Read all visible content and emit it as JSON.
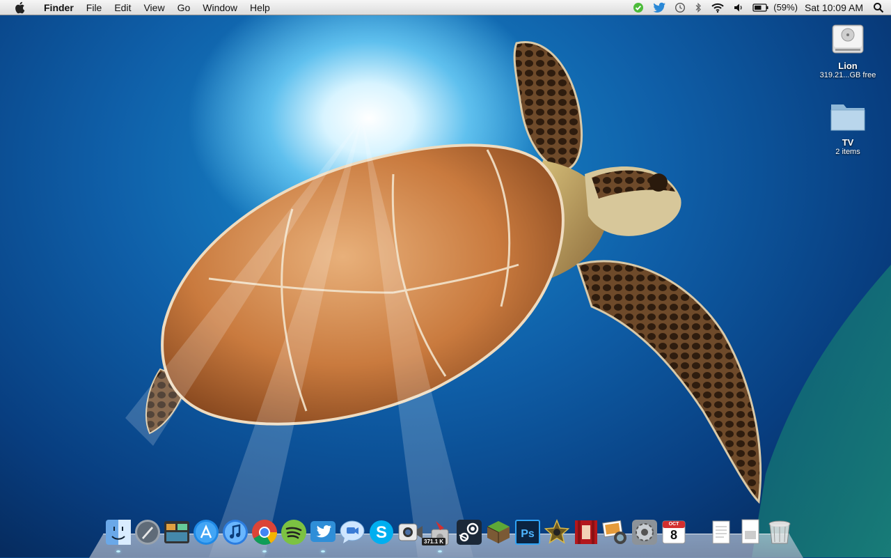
{
  "menubar": {
    "app_name": "Finder",
    "menus": [
      "File",
      "Edit",
      "View",
      "Go",
      "Window",
      "Help"
    ],
    "status_icons": [
      "check-icon",
      "twitter-icon",
      "time-machine-icon",
      "bluetooth-icon",
      "wifi-icon",
      "volume-icon",
      "battery-icon"
    ],
    "battery_percent": "(59%)",
    "clock": "Sat 10:09 AM"
  },
  "desktop": {
    "icons": [
      {
        "name": "Lion",
        "subtitle": "319.21...GB free",
        "type": "hard-drive"
      },
      {
        "name": "TV",
        "subtitle": "2 items",
        "type": "folder"
      }
    ]
  },
  "dock": {
    "items": [
      "Finder",
      "Launchpad",
      "Mission Control",
      "App Store",
      "iTunes",
      "Google Chrome",
      "Spotify",
      "Twitter",
      "Messages",
      "Skype",
      "FaceTime",
      "Transmission",
      "Steam",
      "Minecraft",
      "Photoshop",
      "iMovie",
      "Photo Booth",
      "iPhoto",
      "System Preferences",
      "Calendar",
      "Documents",
      "Downloads",
      "Trash"
    ],
    "transmission_badge": "371.1 K",
    "calendar_month": "OCT",
    "calendar_day": "8"
  },
  "colors": {
    "menubar": "#e6e6e6",
    "water_deep": "#083e80",
    "water_light": "#1a8fd0"
  }
}
